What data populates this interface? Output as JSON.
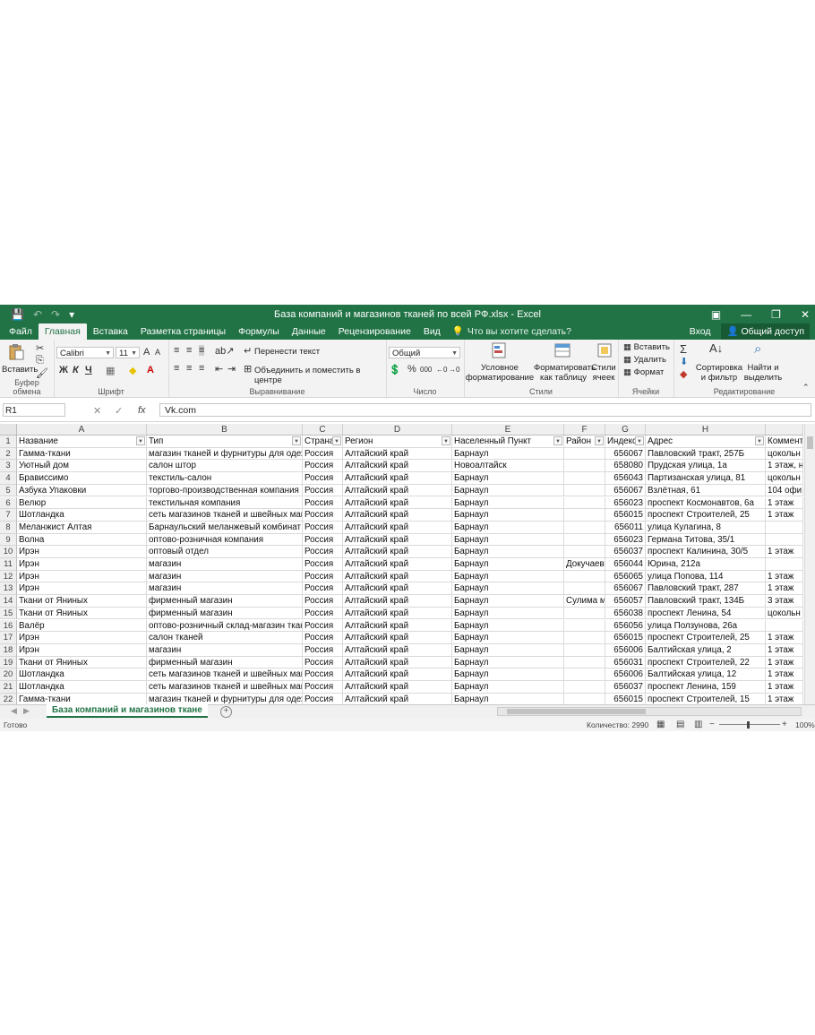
{
  "title_bar": {
    "title": "База компаний и магазинов тканей по всей РФ.xlsx - Excel",
    "save_icon": "💾",
    "undo_icon": "↶",
    "redo_icon": "↷",
    "customize_icon": "▾",
    "ribbon_display_icon": "▣",
    "minimize_icon": "—",
    "restore_icon": "❐",
    "close_icon": "✕"
  },
  "tabs": {
    "file": "Файл",
    "home": "Главная",
    "insert": "Вставка",
    "layout": "Разметка страницы",
    "formulas": "Формулы",
    "data": "Данные",
    "review": "Рецензирование",
    "view": "Вид",
    "tell_me": "Что вы хотите сделать?",
    "signin": "Вход",
    "share": "Общий доступ"
  },
  "ribbon": {
    "clipboard": {
      "paste": "Вставить",
      "label": "Буфер обмена"
    },
    "font": {
      "name": "Calibri",
      "size": "11",
      "bold": "Ж",
      "italic": "К",
      "underline": "Ч",
      "grow": "A",
      "shrink": "A",
      "label": "Шрифт"
    },
    "alignment": {
      "wrap": "Перенести текст",
      "merge": "Объединить и поместить в центре",
      "label": "Выравнивание"
    },
    "number": {
      "format": "Общий",
      "percent": "%",
      "thousands": "000",
      "inc": "←0",
      "dec": "→0",
      "label": "Число"
    },
    "styles": {
      "conditional_1": "Условное",
      "conditional_2": "форматирование",
      "table_1": "Форматировать",
      "table_2": "как таблицу",
      "cell_1": "Стили",
      "cell_2": "ячеек",
      "label": "Стили"
    },
    "cells": {
      "insert": "Вставить",
      "delete": "Удалить",
      "format": "Формат",
      "label": "Ячейки"
    },
    "editing": {
      "sort_1": "Сортировка",
      "sort_2": "и фильтр",
      "find_1": "Найти и",
      "find_2": "выделить",
      "label": "Редактирование"
    }
  },
  "formula_bar": {
    "name_box": "R1",
    "value": "Vk.com",
    "cancel": "✕",
    "enter": "✓",
    "fx": "fx"
  },
  "grid": {
    "column_letters": [
      "A",
      "B",
      "C",
      "D",
      "E",
      "F",
      "G",
      "H",
      ""
    ],
    "headers": [
      "Название",
      "Тип",
      "Страна",
      "Регион",
      "Населенный Пункт",
      "Район",
      "Индекс",
      "Адрес",
      "Коммент"
    ],
    "rows": [
      [
        "Гамма-ткани",
        "магазин тканей и фурнитуры для одеж",
        "Россия",
        "Алтайский край",
        "Барнаул",
        "",
        "656067",
        "Павловский тракт, 257Б",
        "цокольн"
      ],
      [
        "Уютный дом",
        "салон штор",
        "Россия",
        "Алтайский край",
        "Новоалтайск",
        "",
        "658080",
        "Прудская улица, 1а",
        "1 этаж, н"
      ],
      [
        "Брависсимо",
        "текстиль-салон",
        "Россия",
        "Алтайский край",
        "Барнаул",
        "",
        "656043",
        "Партизанская улица, 81",
        "цокольн"
      ],
      [
        "Азбука Упаковки",
        "торгово-производственная компания",
        "Россия",
        "Алтайский край",
        "Барнаул",
        "",
        "656067",
        "Взлётная, 61",
        "104 офи"
      ],
      [
        "Велюр",
        "текстильная компания",
        "Россия",
        "Алтайский край",
        "Барнаул",
        "",
        "656023",
        "проспект Космонавтов, 6а",
        "1 этаж"
      ],
      [
        "Шотландка",
        "сеть магазинов тканей и швейных маш",
        "Россия",
        "Алтайский край",
        "Барнаул",
        "",
        "656015",
        "проспект Строителей, 25",
        "1 этаж"
      ],
      [
        "Меланжист Алтая",
        "Барнаульский меланжевый комбинат",
        "Россия",
        "Алтайский край",
        "Барнаул",
        "",
        "656011",
        "улица Кулагина, 8",
        ""
      ],
      [
        "Волна",
        "оптово-розничная компания",
        "Россия",
        "Алтайский край",
        "Барнаул",
        "",
        "656023",
        "Германа Титова, 35/1",
        ""
      ],
      [
        "Ирэн",
        "оптовый отдел",
        "Россия",
        "Алтайский край",
        "Барнаул",
        "",
        "656037",
        "проспект Калинина, 30/5",
        "1 этаж"
      ],
      [
        "Ирэн",
        "магазин",
        "Россия",
        "Алтайский край",
        "Барнаул",
        "Докучаево",
        "656044",
        "Юрина, 212а",
        ""
      ],
      [
        "Ирэн",
        "магазин",
        "Россия",
        "Алтайский край",
        "Барнаул",
        "",
        "656065",
        "улица Попова, 114",
        "1 этаж"
      ],
      [
        "Ирэн",
        "магазин",
        "Россия",
        "Алтайский край",
        "Барнаул",
        "",
        "656067",
        "Павловский тракт, 287",
        "1 этаж"
      ],
      [
        "Ткани от Яниных",
        "фирменный магазин",
        "Россия",
        "Алтайский край",
        "Барнаул",
        "Сулима м",
        "656057",
        "Павловский тракт, 134Б",
        "3 этаж"
      ],
      [
        "Ткани от Яниных",
        "фирменный магазин",
        "Россия",
        "Алтайский край",
        "Барнаул",
        "",
        "656038",
        "проспект Ленина, 54",
        "цокольн"
      ],
      [
        "Валёр",
        "оптово-розничный склад-магазин ткан",
        "Россия",
        "Алтайский край",
        "Барнаул",
        "",
        "656056",
        "улица Ползунова, 26а",
        ""
      ],
      [
        "Ирэн",
        "салон тканей",
        "Россия",
        "Алтайский край",
        "Барнаул",
        "",
        "656015",
        "проспект Строителей, 25",
        "1 этаж"
      ],
      [
        "Ирэн",
        "магазин",
        "Россия",
        "Алтайский край",
        "Барнаул",
        "",
        "656006",
        "Балтийская улица, 2",
        "1 этаж"
      ],
      [
        "Ткани от Яниных",
        "фирменный магазин",
        "Россия",
        "Алтайский край",
        "Барнаул",
        "",
        "656031",
        "проспект Строителей, 22",
        "1 этаж"
      ],
      [
        "Шотландка",
        "сеть магазинов тканей и швейных маш",
        "Россия",
        "Алтайский край",
        "Барнаул",
        "",
        "656006",
        "Балтийская улица, 12",
        "1 этаж"
      ],
      [
        "Шотландка",
        "сеть магазинов тканей и швейных маш",
        "Россия",
        "Алтайский край",
        "Барнаул",
        "",
        "656037",
        "проспект Ленина, 159",
        "1 этаж"
      ],
      [
        "Гамма-ткани",
        "магазин тканей и фурнитуры для одеж",
        "Россия",
        "Алтайский край",
        "Барнаул",
        "",
        "656015",
        "проспект Строителей, 15",
        "1 этаж"
      ]
    ]
  },
  "sheet": {
    "name": "База компаний и магазинов ткане",
    "add": "+"
  },
  "status": {
    "ready": "Готово",
    "count": "Количество: 2990",
    "zoom": "100%",
    "minus": "−",
    "plus": "+"
  },
  "colors": {
    "accent": "#217346",
    "ribbon_bg": "#f3f3f3"
  }
}
